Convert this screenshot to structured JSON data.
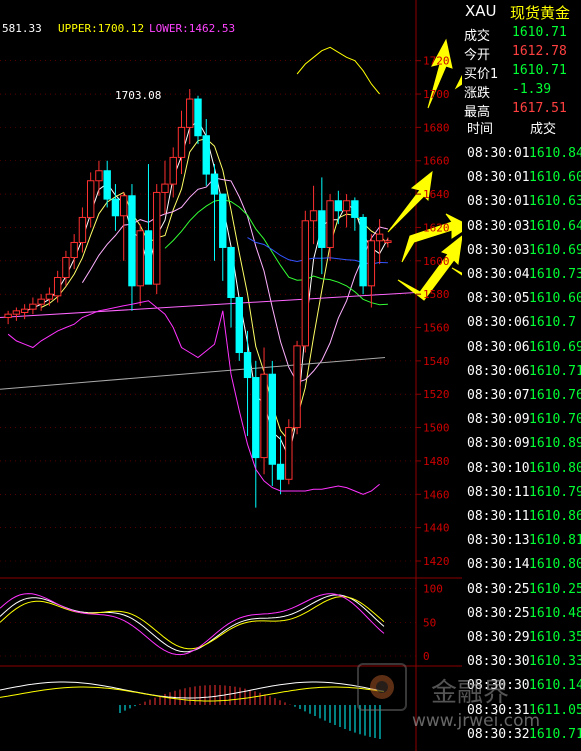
{
  "header": {
    "first_value": "581.33",
    "upper_label": "UPPER:1700.12",
    "lower_label": "LOWER:1462.53"
  },
  "chart_labels": {
    "peak_label": "1703.08"
  },
  "chart_data": [
    {
      "type": "candlestick",
      "title": "",
      "y_ticks": [
        "1720",
        "1700",
        "1680",
        "1660",
        "1640",
        "1620",
        "1600",
        "1580",
        "1560",
        "1540",
        "1520",
        "1500",
        "1480",
        "1460",
        "1440",
        "1420"
      ],
      "ylim": [
        1420,
        1730
      ],
      "candles": [
        {
          "o": 1566,
          "h": 1570,
          "l": 1562,
          "c": 1568
        },
        {
          "o": 1568,
          "h": 1572,
          "l": 1564,
          "c": 1570
        },
        {
          "o": 1569,
          "h": 1574,
          "l": 1565,
          "c": 1571
        },
        {
          "o": 1571,
          "h": 1578,
          "l": 1568,
          "c": 1574
        },
        {
          "o": 1574,
          "h": 1580,
          "l": 1570,
          "c": 1577
        },
        {
          "o": 1577,
          "h": 1584,
          "l": 1573,
          "c": 1580
        },
        {
          "o": 1579,
          "h": 1594,
          "l": 1575,
          "c": 1590
        },
        {
          "o": 1590,
          "h": 1606,
          "l": 1585,
          "c": 1602
        },
        {
          "o": 1602,
          "h": 1616,
          "l": 1595,
          "c": 1611
        },
        {
          "o": 1611,
          "h": 1632,
          "l": 1605,
          "c": 1626
        },
        {
          "o": 1626,
          "h": 1653,
          "l": 1620,
          "c": 1648
        },
        {
          "o": 1648,
          "h": 1660,
          "l": 1639,
          "c": 1654
        },
        {
          "o": 1654,
          "h": 1660,
          "l": 1632,
          "c": 1637
        },
        {
          "o": 1637,
          "h": 1646,
          "l": 1618,
          "c": 1627
        },
        {
          "o": 1627,
          "h": 1641,
          "l": 1600,
          "c": 1639
        },
        {
          "o": 1639,
          "h": 1646,
          "l": 1570,
          "c": 1585
        },
        {
          "o": 1585,
          "h": 1622,
          "l": 1573,
          "c": 1618
        },
        {
          "o": 1618,
          "h": 1658,
          "l": 1592,
          "c": 1586
        },
        {
          "o": 1586,
          "h": 1646,
          "l": 1580,
          "c": 1641
        },
        {
          "o": 1641,
          "h": 1660,
          "l": 1628,
          "c": 1646
        },
        {
          "o": 1646,
          "h": 1668,
          "l": 1638,
          "c": 1662
        },
        {
          "o": 1662,
          "h": 1690,
          "l": 1652,
          "c": 1680
        },
        {
          "o": 1680,
          "h": 1703,
          "l": 1670,
          "c": 1697
        },
        {
          "o": 1697,
          "h": 1699,
          "l": 1670,
          "c": 1675
        },
        {
          "o": 1675,
          "h": 1685,
          "l": 1645,
          "c": 1652
        },
        {
          "o": 1652,
          "h": 1658,
          "l": 1600,
          "c": 1640
        },
        {
          "o": 1640,
          "h": 1640,
          "l": 1588,
          "c": 1608
        },
        {
          "o": 1608,
          "h": 1608,
          "l": 1560,
          "c": 1578
        },
        {
          "o": 1578,
          "h": 1578,
          "l": 1540,
          "c": 1545
        },
        {
          "o": 1545,
          "h": 1558,
          "l": 1495,
          "c": 1530
        },
        {
          "o": 1530,
          "h": 1540,
          "l": 1452,
          "c": 1482
        },
        {
          "o": 1482,
          "h": 1548,
          "l": 1472,
          "c": 1532
        },
        {
          "o": 1532,
          "h": 1540,
          "l": 1465,
          "c": 1478
        },
        {
          "o": 1478,
          "h": 1495,
          "l": 1460,
          "c": 1469
        },
        {
          "o": 1469,
          "h": 1505,
          "l": 1466,
          "c": 1500
        },
        {
          "o": 1500,
          "h": 1552,
          "l": 1496,
          "c": 1549
        },
        {
          "o": 1549,
          "h": 1630,
          "l": 1545,
          "c": 1624
        },
        {
          "o": 1624,
          "h": 1645,
          "l": 1610,
          "c": 1630
        },
        {
          "o": 1630,
          "h": 1650,
          "l": 1592,
          "c": 1608
        },
        {
          "o": 1608,
          "h": 1640,
          "l": 1600,
          "c": 1636
        },
        {
          "o": 1636,
          "h": 1642,
          "l": 1622,
          "c": 1630
        },
        {
          "o": 1630,
          "h": 1640,
          "l": 1620,
          "c": 1636
        },
        {
          "o": 1636,
          "h": 1638,
          "l": 1618,
          "c": 1626
        },
        {
          "o": 1626,
          "h": 1628,
          "l": 1580,
          "c": 1585
        },
        {
          "o": 1585,
          "h": 1616,
          "l": 1572,
          "c": 1612
        },
        {
          "o": 1612,
          "h": 1625,
          "l": 1598,
          "c": 1616
        },
        {
          "o": 1611,
          "h": 1614,
          "l": 1608,
          "c": 1612
        }
      ],
      "bollinger_upper": [
        null,
        null,
        null,
        null,
        null,
        null,
        null,
        null,
        null,
        null,
        null,
        null,
        null,
        null,
        null,
        null,
        null,
        null,
        null,
        null,
        null,
        null,
        null,
        null,
        null,
        null,
        null,
        null,
        null,
        null,
        null,
        null,
        null,
        null,
        null,
        1712,
        1718,
        1722,
        1726,
        1728,
        1725,
        1722,
        1720,
        1714,
        1706,
        1700
      ],
      "bollinger_lower": [
        1556,
        1552,
        1550,
        1548,
        1552,
        1555,
        1558,
        1560,
        1562,
        1566,
        1568,
        1570,
        1571,
        1572,
        1573,
        1574,
        1575,
        1576,
        1572,
        1568,
        1560,
        1548,
        1545,
        1542,
        1546,
        1550,
        1570,
        1532,
        1510,
        1490,
        1475,
        1468,
        1464,
        1462,
        1462,
        1462,
        1462,
        1463,
        1463,
        1464,
        1465,
        1464,
        1462,
        1460,
        1462,
        1466
      ]
    },
    {
      "type": "line",
      "title": "",
      "y_ticks": [
        "100",
        "50",
        "0"
      ],
      "ylim": [
        0,
        110
      ]
    },
    {
      "type": "bar",
      "title": "",
      "y_ticks": []
    }
  ],
  "quote": {
    "symbol": "XAU",
    "name": "现货黄金",
    "fields": [
      {
        "label": "成交",
        "value": "1610.71",
        "color": "#00ff33"
      },
      {
        "label": "今开",
        "value": "1612.78",
        "color": "#ff4040"
      },
      {
        "label": "买价1",
        "value": "1610.71",
        "color": "#00ff33"
      },
      {
        "label": "涨跌",
        "value": "-1.39",
        "color": "#00ff33"
      },
      {
        "label": "最高",
        "value": "1617.51",
        "color": "#ff4040"
      }
    ]
  },
  "trades": {
    "col_time": "时间",
    "col_price": "成交",
    "rows": [
      {
        "time": "08:30:01",
        "price": "1610.84"
      },
      {
        "time": "08:30:01",
        "price": "1610.60"
      },
      {
        "time": "08:30:01",
        "price": "1610.63"
      },
      {
        "time": "08:30:03",
        "price": "1610.64"
      },
      {
        "time": "08:30:03",
        "price": "1610.69"
      },
      {
        "time": "08:30:04",
        "price": "1610.73"
      },
      {
        "time": "08:30:05",
        "price": "1610.60"
      },
      {
        "time": "08:30:06",
        "price": "1610.7"
      },
      {
        "time": "08:30:06",
        "price": "1610.69"
      },
      {
        "time": "08:30:06",
        "price": "1610.71"
      },
      {
        "time": "08:30:07",
        "price": "1610.76"
      },
      {
        "time": "08:30:09",
        "price": "1610.70"
      },
      {
        "time": "08:30:09",
        "price": "1610.89"
      },
      {
        "time": "08:30:10",
        "price": "1610.80"
      },
      {
        "time": "08:30:11",
        "price": "1610.79"
      },
      {
        "time": "08:30:11",
        "price": "1610.86"
      },
      {
        "time": "08:30:13",
        "price": "1610.81"
      },
      {
        "time": "08:30:14",
        "price": "1610.80"
      },
      {
        "time": "08:30:25",
        "price": "1610.25"
      },
      {
        "time": "08:30:25",
        "price": "1610.48"
      },
      {
        "time": "08:30:29",
        "price": "1610.35"
      },
      {
        "time": "08:30:30",
        "price": "1610.33"
      },
      {
        "time": "08:30:30",
        "price": "1610.14"
      },
      {
        "time": "08:30:31",
        "price": "1611.05"
      },
      {
        "time": "08:30:32",
        "price": "1610.71"
      }
    ]
  },
  "watermark": {
    "name": "金融界",
    "url": "www.jrwei.com"
  },
  "colors": {
    "up": "#ff3030",
    "down": "#00ffff",
    "grid": "#8b0000",
    "axis_text": "#cc0000",
    "arrow": "#ffff00"
  }
}
